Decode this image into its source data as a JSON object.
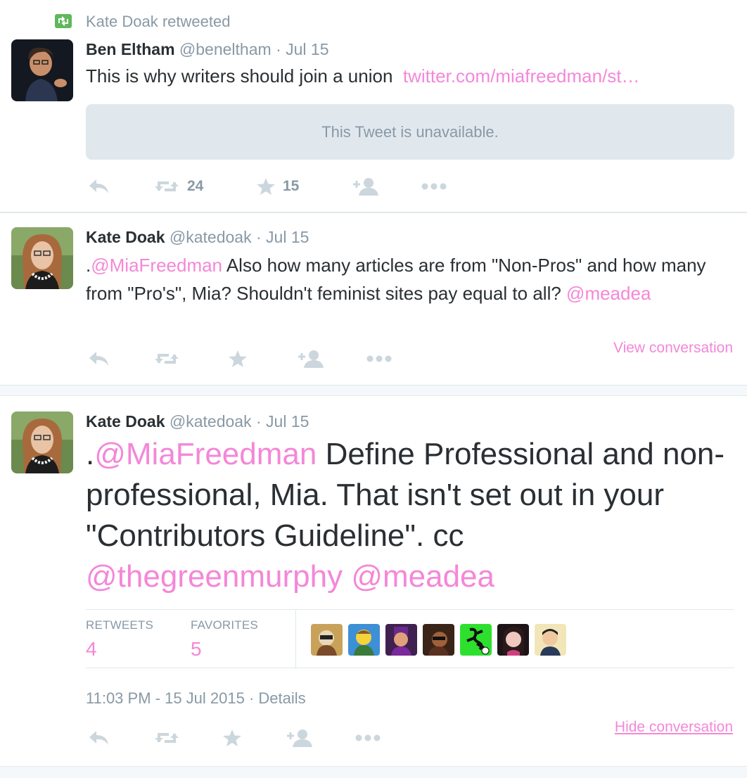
{
  "retweet_context": {
    "text": "Kate Doak retweeted"
  },
  "tweets": [
    {
      "name": "Ben Eltham",
      "handle": "@beneltham",
      "sep": " · ",
      "date": "Jul 15",
      "text_plain": "This is why writers should join a union",
      "text_link": "twitter.com/miafreedman/st…",
      "quoted_unavailable": "This Tweet is unavailable.",
      "retweets": "24",
      "favorites": "15"
    },
    {
      "name": "Kate Doak",
      "handle": "@katedoak",
      "sep": " · ",
      "date": "Jul 15",
      "text_prefix": ".",
      "mention1": "@MiaFreedman",
      "text_body": " Also how many articles are from \"Non-Pros\" and how many from \"Pro's\", Mia? Shouldn't feminist sites pay equal to all?",
      "mention2": "@meadea",
      "convo_link": "View conversation"
    },
    {
      "name": "Kate Doak",
      "handle": "@katedoak",
      "sep": " · ",
      "date": "Jul 15",
      "text_prefix": ".",
      "mention1": "@MiaFreedman",
      "text_body": " Define Professional and non-professional, Mia. That isn't set out in your \"Contributors Guideline\". cc ",
      "mention2": "@thegreenmurphy",
      "mention3": "@meadea",
      "stats": {
        "retweets_label": "RETWEETS",
        "retweets_value": "4",
        "favorites_label": "FAVORITES",
        "favorites_value": "5"
      },
      "timestamp": "11:03 PM - 15 Jul 2015",
      "details_sep": " · ",
      "details": "Details",
      "convo_link": "Hide conversation"
    }
  ],
  "colors": {
    "accent_link": "#f487d8",
    "muted": "#8899a6",
    "retweet_green": "#5fb85c",
    "icon_gray": "#ccd6dd"
  },
  "icons": [
    "retweet-badge-icon",
    "reply-icon",
    "retweet-icon",
    "favorite-star-icon",
    "follow-icon",
    "more-icon"
  ]
}
